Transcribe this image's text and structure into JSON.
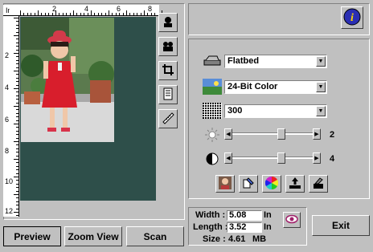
{
  "ruler": {
    "corner": "In",
    "top_labels": [
      "2",
      "4",
      "6",
      "8"
    ],
    "left_labels": [
      "2",
      "4",
      "6",
      "8",
      "10",
      "12"
    ]
  },
  "buttons": {
    "preview": "Preview",
    "zoom_view": "Zoom View",
    "scan": "Scan",
    "exit": "Exit"
  },
  "settings": {
    "source": "Flatbed",
    "color_mode": "24-Bit Color",
    "resolution": "300",
    "brightness_value": "2",
    "contrast_value": "4",
    "brightness_level": 0.62,
    "contrast_level": 0.62
  },
  "size": {
    "width_label": "Width :",
    "width_value": "5.08",
    "length_label": "Length :",
    "length_value": "3.52",
    "unit": "In",
    "size_label": "Size :",
    "size_value": "4.61",
    "size_unit": "MB"
  },
  "icons": {
    "tools": [
      "face-icon",
      "mirror-icon",
      "crop-icon",
      "document-icon",
      "ruler-icon"
    ],
    "info": "info-icon",
    "eye": "eye-icon"
  }
}
